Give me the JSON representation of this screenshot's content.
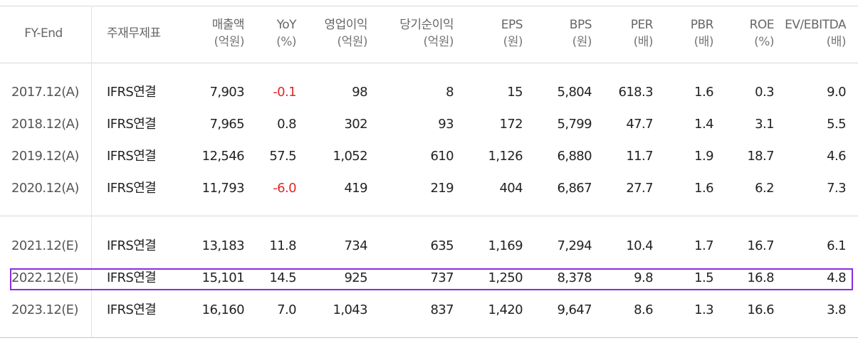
{
  "table": {
    "headers": [
      {
        "line1": "FY-End",
        "line2": ""
      },
      {
        "line1": "주재무제표",
        "line2": ""
      },
      {
        "line1": "매출액",
        "line2": "(억원)"
      },
      {
        "line1": "YoY",
        "line2": "(%)"
      },
      {
        "line1": "영업이익",
        "line2": "(억원)"
      },
      {
        "line1": "당기순이익",
        "line2": "(억원)"
      },
      {
        "line1": "EPS",
        "line2": "(원)"
      },
      {
        "line1": "BPS",
        "line2": "(원)"
      },
      {
        "line1": "PER",
        "line2": "(배)"
      },
      {
        "line1": "PBR",
        "line2": "(배)"
      },
      {
        "line1": "ROE",
        "line2": "(%)"
      },
      {
        "line1": "EV/EBITDA",
        "line2": "(배)"
      }
    ],
    "rows": [
      {
        "fy": "2017.12(A)",
        "basis": "IFRS연결",
        "sales": "7,903",
        "yoy": "-0.1",
        "op": "98",
        "net": "8",
        "eps": "15",
        "bps": "5,804",
        "per": "618.3",
        "pbr": "1.6",
        "roe": "0.3",
        "ev": "9.0"
      },
      {
        "fy": "2018.12(A)",
        "basis": "IFRS연결",
        "sales": "7,965",
        "yoy": "0.8",
        "op": "302",
        "net": "93",
        "eps": "172",
        "bps": "5,799",
        "per": "47.7",
        "pbr": "1.4",
        "roe": "3.1",
        "ev": "5.5"
      },
      {
        "fy": "2019.12(A)",
        "basis": "IFRS연결",
        "sales": "12,546",
        "yoy": "57.5",
        "op": "1,052",
        "net": "610",
        "eps": "1,126",
        "bps": "6,880",
        "per": "11.7",
        "pbr": "1.9",
        "roe": "18.7",
        "ev": "4.6"
      },
      {
        "fy": "2020.12(A)",
        "basis": "IFRS연결",
        "sales": "11,793",
        "yoy": "-6.0",
        "op": "419",
        "net": "219",
        "eps": "404",
        "bps": "6,867",
        "per": "27.7",
        "pbr": "1.6",
        "roe": "6.2",
        "ev": "7.3"
      },
      {
        "fy": "2021.12(E)",
        "basis": "IFRS연결",
        "sales": "13,183",
        "yoy": "11.8",
        "op": "734",
        "net": "635",
        "eps": "1,169",
        "bps": "7,294",
        "per": "10.4",
        "pbr": "1.7",
        "roe": "16.7",
        "ev": "6.1"
      },
      {
        "fy": "2022.12(E)",
        "basis": "IFRS연결",
        "sales": "15,101",
        "yoy": "14.5",
        "op": "925",
        "net": "737",
        "eps": "1,250",
        "bps": "8,378",
        "per": "9.8",
        "pbr": "1.5",
        "roe": "16.8",
        "ev": "4.8"
      },
      {
        "fy": "2023.12(E)",
        "basis": "IFRS연결",
        "sales": "16,160",
        "yoy": "7.0",
        "op": "1,043",
        "net": "837",
        "eps": "1,420",
        "bps": "9,647",
        "per": "8.6",
        "pbr": "1.3",
        "roe": "16.6",
        "ev": "3.8"
      }
    ],
    "highlighted_row": "2022.12(E)"
  },
  "colors": {
    "negative": "#e22525",
    "highlight_border": "#8a2be2",
    "header_text": "#666666",
    "grid_line": "#d6d6d6"
  }
}
